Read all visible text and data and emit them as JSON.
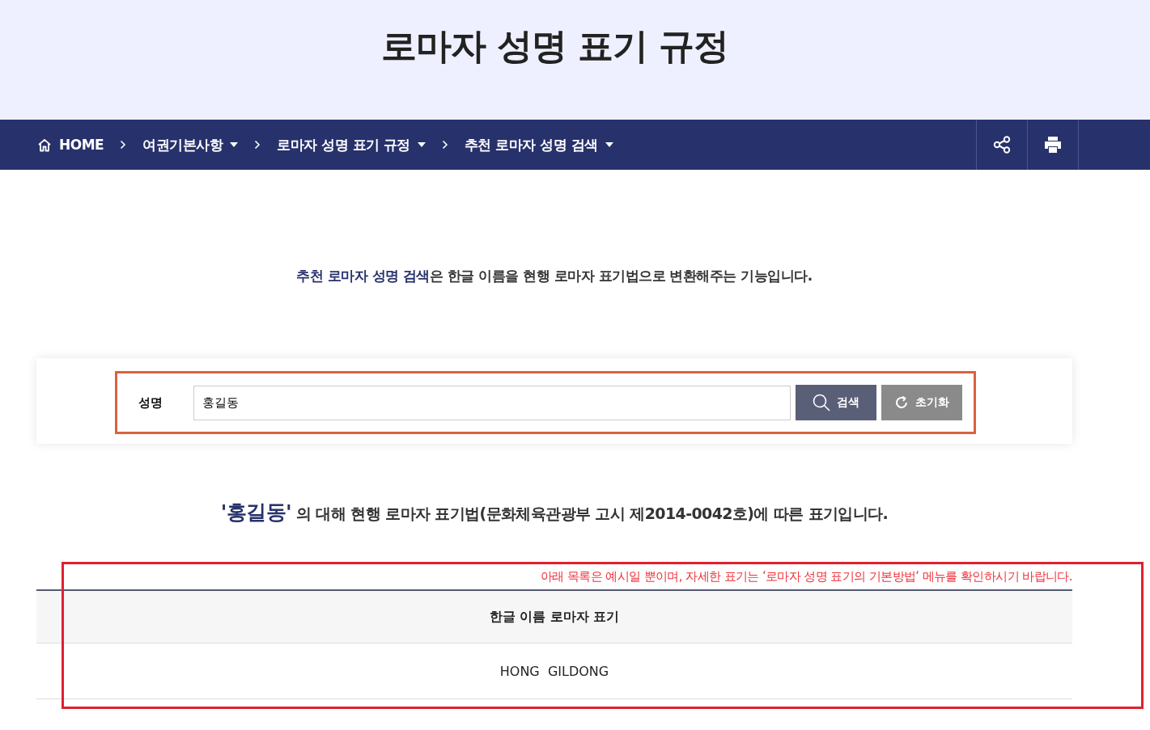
{
  "page_title": "로마자 성명 표기 규정",
  "breadcrumb": [
    {
      "kind": "home",
      "label": "HOME"
    },
    {
      "kind": "menu",
      "label": "여권기본사항"
    },
    {
      "kind": "menu",
      "label": "로마자 성명 표기 규정"
    },
    {
      "kind": "menu",
      "label": "추천 로마자 성명 검색"
    }
  ],
  "intro": {
    "highlight": "추천 로마자 성명 검색",
    "text": "은 한글 이름을 현행 로마자 표기법으로 변환해주는 기능입니다."
  },
  "search": {
    "label": "성명",
    "value": "홍길동",
    "search_button": "검색",
    "reset_button": "초기화"
  },
  "result_heading": {
    "name": "'홍길동'",
    "text": " 의 대해 현행 로마자 표기법(문화체육관광부 고시 제2014-0042호)에 따른 표기입니다."
  },
  "notice": "아래 목록은 예시일 뿐이며, 자세한 표기는 ‘로마자 성명 표기의 기본방법‘ 메뉴를 확인하시기 바랍니다.",
  "table": {
    "columns": [
      "한글 이름 로마자 표기"
    ],
    "rows": [
      [
        "HONG  GILDONG"
      ]
    ]
  }
}
